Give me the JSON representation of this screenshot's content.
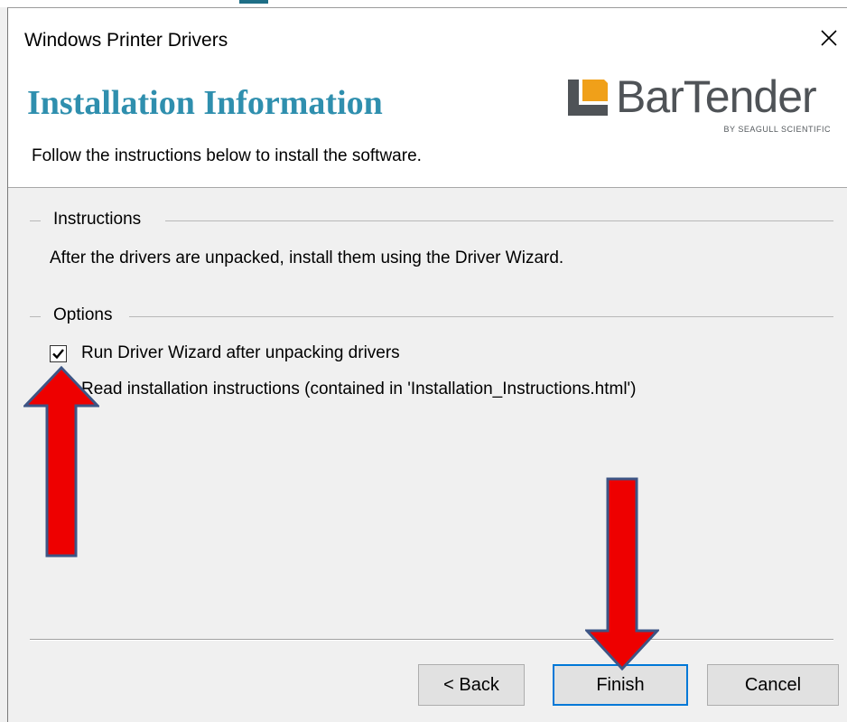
{
  "window": {
    "title": "Windows Printer Drivers",
    "close_icon": "close-icon"
  },
  "header": {
    "title": "Installation Information",
    "subtitle": "Follow the instructions below to install the software.",
    "logo": {
      "name": "BarTender",
      "tagline": "BY SEAGULL SCIENTIFIC",
      "color": "#4f5357",
      "accent": "#f0a019"
    }
  },
  "instructions": {
    "legend": "Instructions",
    "text": "After the drivers are unpacked, install them using the Driver Wizard."
  },
  "options": {
    "legend": "Options",
    "items": [
      {
        "label": "Run Driver Wizard after unpacking drivers",
        "checked": true
      },
      {
        "label": "Read installation instructions (contained in 'Installation_Instructions.html')",
        "checked": false
      }
    ]
  },
  "buttons": {
    "back": "< Back",
    "finish": "Finish",
    "cancel": "Cancel"
  },
  "annotations": {
    "arrow_color": "#ee0000",
    "arrow_outline": "#3d5585"
  }
}
